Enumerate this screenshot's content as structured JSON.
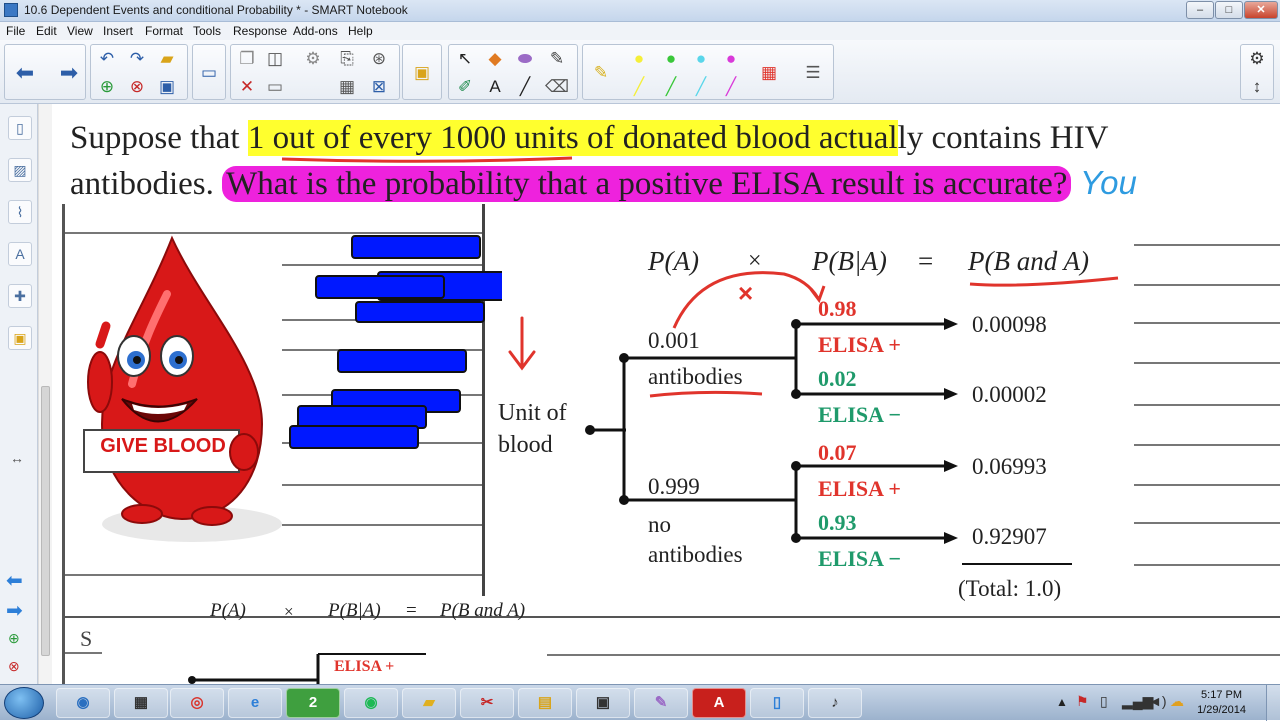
{
  "window": {
    "title": "10.6 Dependent Events and conditional Probability * - SMART Notebook",
    "controls": {
      "minimize": "–",
      "maximize": "□",
      "close": "✕"
    }
  },
  "menu": [
    "File",
    "Edit",
    "View",
    "Insert",
    "Format",
    "Tools",
    "Response",
    "Add-ons",
    "Help"
  ],
  "toolbar_icons": [
    "back-arrow",
    "forward-arrow",
    "undo",
    "redo",
    "open-file",
    "add-page",
    "delete-page",
    "save",
    "screen-shade",
    "full-screen",
    "paste",
    "cut",
    "document-camera",
    "insert-table",
    "select",
    "pens",
    "eraser",
    "text",
    "line",
    "highlighter",
    "color-palette",
    "settings",
    "move-toolbar"
  ],
  "question": {
    "part1_plain": "Suppose that ",
    "part1_yellow": "1 out of every 1000 units of donated blood actual",
    "part1_rest": "ly contains HIV",
    "part2_plain": "antibodies. ",
    "part2_magenta": "What is the probability that a positive ELISA result is accurate?",
    "part2_note": " You"
  },
  "sticker_text": "GIVE BLOOD",
  "diagram": {
    "header": {
      "pa": "P(A)",
      "times": "×",
      "pba": "P(B|A)",
      "equals": "=",
      "pbanda": "P(B and A)"
    },
    "x_mark": "×",
    "root_label": [
      "Unit of",
      "blood"
    ],
    "branch_antibodies": {
      "prob": "0.001",
      "label": "antibodies"
    },
    "branch_no_antibodies": {
      "prob": "0.999",
      "label_1": "no",
      "label_2": "antibodies"
    },
    "leaves": [
      {
        "prob": "0.98",
        "label": "ELISA +",
        "result": "0.00098"
      },
      {
        "prob": "0.02",
        "label": "ELISA −",
        "result": "0.00002"
      },
      {
        "prob": "0.07",
        "label": "ELISA +",
        "result": "0.06993"
      },
      {
        "prob": "0.93",
        "label": "ELISA −",
        "result": "0.92907"
      }
    ],
    "total": "(Total: 1.0)"
  },
  "second_header": {
    "pa": "P(A)",
    "times": "×",
    "pba": "P(B|A)",
    "equals": "=",
    "pbanda": "P(B and A)"
  },
  "second_leaf": "ELISA +",
  "cut_off_letter": "S",
  "taskbar": {
    "apps": [
      "start",
      "network",
      "calculator",
      "chrome",
      "internet-explorer",
      "smart-notebook",
      "spotify",
      "folder",
      "snipping-tool",
      "file-explorer",
      "terminal",
      "paint",
      "acrobat",
      "notebook",
      "mixer"
    ],
    "notebook_badge": "2",
    "time": "5:17 PM",
    "date": "1/29/2014"
  },
  "colors": {
    "highlight_yellow": "#ffff2e",
    "highlight_magenta": "#ee22dd",
    "ink_red": "#e0342c",
    "ink_green": "#1f9a6b",
    "redaction_blue": "#0018ff"
  }
}
